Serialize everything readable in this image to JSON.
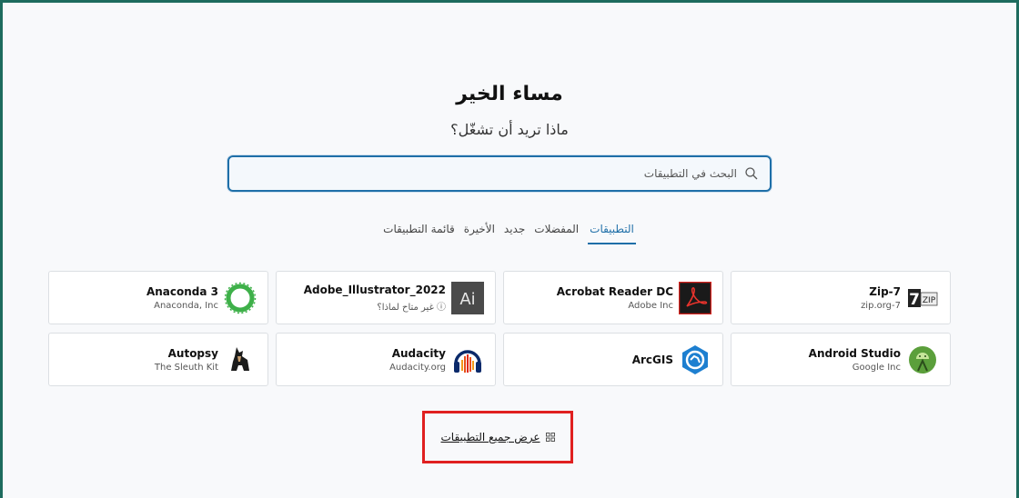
{
  "header": {
    "greeting": "مساء الخير",
    "subtitle": "ماذا تريد أن تشغّل؟"
  },
  "search": {
    "placeholder": "البحث في التطبيقات",
    "icon": "search-icon"
  },
  "tabs": [
    {
      "label": "التطبيقات",
      "active": true
    },
    {
      "label": "المفضلات",
      "active": false
    },
    {
      "label": "جديد",
      "active": false
    },
    {
      "label": "الأخيرة",
      "active": false
    },
    {
      "label": "قائمة التطبيقات",
      "active": false
    }
  ],
  "apps": [
    {
      "name": "Zip-7",
      "publisher": "zip.org-7",
      "icon": "7zip-icon"
    },
    {
      "name": "Acrobat Reader DC",
      "publisher": "Adobe Inc",
      "icon": "acrobat-icon"
    },
    {
      "name": "Adobe_Illustrator_2022",
      "publisher": "غير متاح لماذا؟",
      "icon": "illustrator-icon",
      "info_icon": "ⓘ"
    },
    {
      "name": "Anaconda 3",
      "publisher": "Anaconda, Inc",
      "icon": "anaconda-icon"
    },
    {
      "name": "Android Studio",
      "publisher": "Google Inc",
      "icon": "android-studio-icon"
    },
    {
      "name": "ArcGIS",
      "publisher": "",
      "icon": "arcgis-icon"
    },
    {
      "name": "Audacity",
      "publisher": "Audacity.org",
      "icon": "audacity-icon"
    },
    {
      "name": "Autopsy",
      "publisher": "The Sleuth Kit",
      "icon": "autopsy-icon"
    }
  ],
  "show_all": {
    "label": "عرض جميع التطبيقات",
    "icon": "grid-icon"
  },
  "colors": {
    "accent": "#1f6fa8",
    "frame": "#1e6b5e",
    "highlight": "#e02020"
  }
}
